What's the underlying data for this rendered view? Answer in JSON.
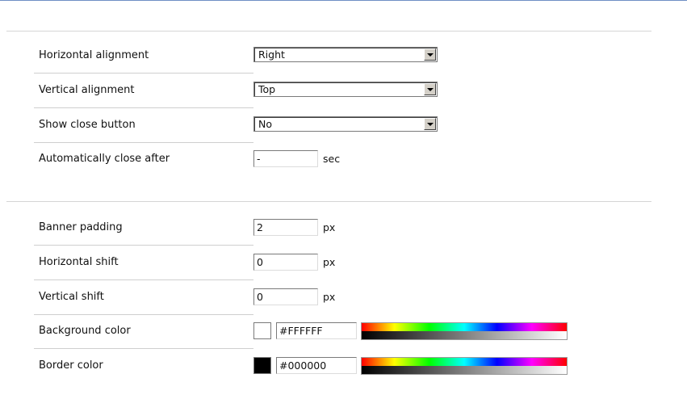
{
  "section1": {
    "horizontal_alignment": {
      "label": "Horizontal alignment",
      "value": "Right"
    },
    "vertical_alignment": {
      "label": "Vertical alignment",
      "value": "Top"
    },
    "show_close_button": {
      "label": "Show close button",
      "value": "No"
    },
    "auto_close": {
      "label": "Automatically close after",
      "value": "-",
      "unit": "sec"
    }
  },
  "section2": {
    "banner_padding": {
      "label": "Banner padding",
      "value": "2",
      "unit": "px"
    },
    "horizontal_shift": {
      "label": "Horizontal shift",
      "value": "0",
      "unit": "px"
    },
    "vertical_shift": {
      "label": "Vertical shift",
      "value": "0",
      "unit": "px"
    },
    "background_color": {
      "label": "Background color",
      "value": "#FFFFFF",
      "swatch": "#FFFFFF"
    },
    "border_color": {
      "label": "Border color",
      "value": "#000000",
      "swatch": "#000000"
    }
  }
}
